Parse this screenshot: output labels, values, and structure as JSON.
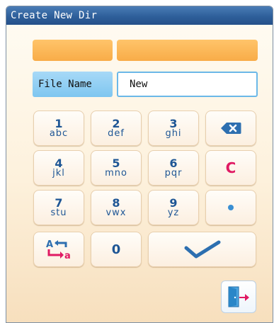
{
  "window": {
    "title": "Create New Dir"
  },
  "form": {
    "label": "File Name",
    "value": "New"
  },
  "keypad": {
    "keys": [
      {
        "num": "1",
        "letters": "abc"
      },
      {
        "num": "2",
        "letters": "def"
      },
      {
        "num": "3",
        "letters": "ghi"
      },
      {
        "num": "4",
        "letters": "jkl"
      },
      {
        "num": "5",
        "letters": "mno"
      },
      {
        "num": "6",
        "letters": "pqr"
      },
      {
        "num": "7",
        "letters": "stu"
      },
      {
        "num": "8",
        "letters": "vwx"
      },
      {
        "num": "9",
        "letters": "yz"
      }
    ],
    "clear_label": "C",
    "zero_label": "0",
    "icons": {
      "backspace": "backspace-icon",
      "dot": "dot-icon",
      "case_toggle": "case-toggle-icon",
      "confirm": "checkmark-icon",
      "exit": "exit-door-icon"
    }
  },
  "colors": {
    "title_bar": "#2e5f9a",
    "accent_orange": "#f8ac48",
    "label_blue": "#7ec6f0",
    "key_text": "#1e5695",
    "clear_pink": "#e01a63"
  }
}
